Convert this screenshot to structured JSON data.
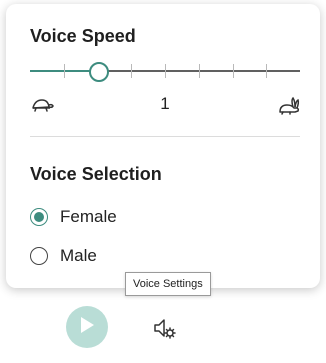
{
  "voice_speed": {
    "title": "Voice Speed",
    "value": "1",
    "slider_fraction": 0.25,
    "tick_count": 8,
    "slow_icon": "turtle-icon",
    "fast_icon": "rabbit-icon"
  },
  "voice_selection": {
    "title": "Voice Selection",
    "options": [
      {
        "label": "Female",
        "checked": true
      },
      {
        "label": "Male",
        "checked": false
      }
    ]
  },
  "tooltip": {
    "text": "Voice Settings"
  },
  "controls": {
    "play_icon": "play-icon",
    "settings_icon": "speaker-settings-icon"
  },
  "colors": {
    "accent": "#3d8c7f",
    "play_bg": "#b9ddd6"
  }
}
